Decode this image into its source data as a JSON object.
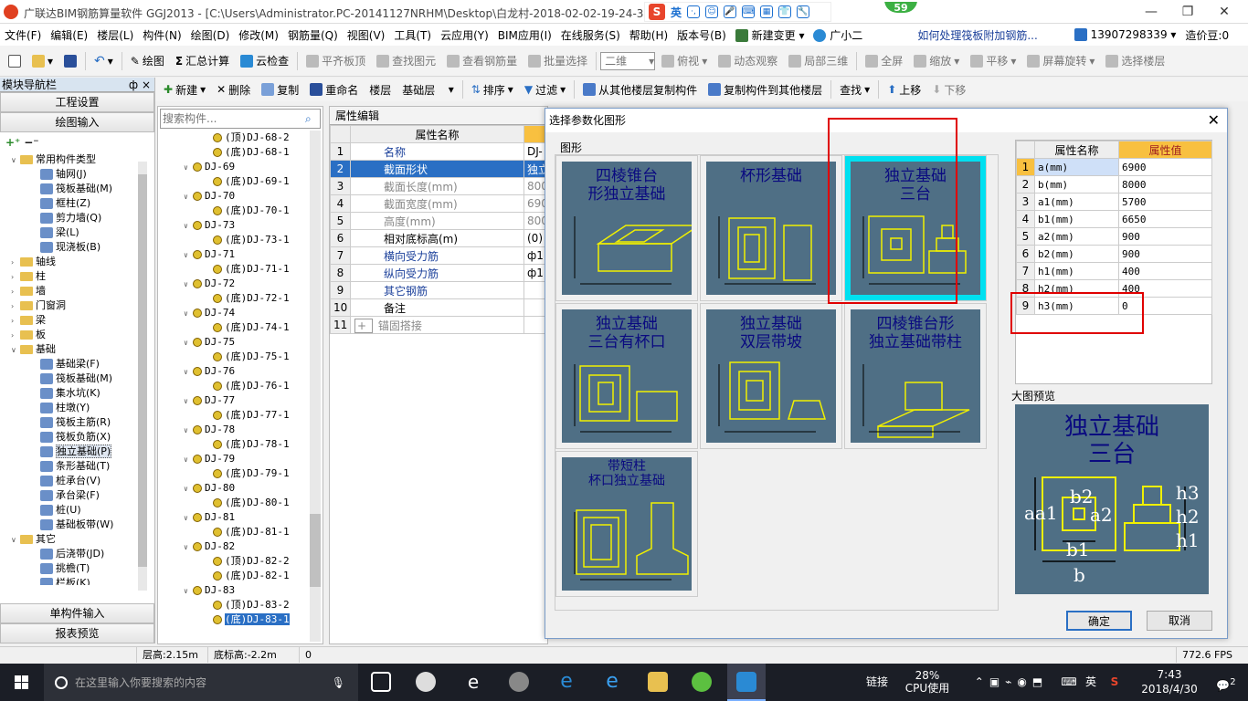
{
  "window": {
    "title": "广联达BIM钢筋算量软件 GGJ2013 - [C:\\Users\\Administrator.PC-20141127NRHM\\Desktop\\白龙村-2018-02-02-19-24-35"
  },
  "ime": {
    "lang": "英",
    "brand": "S"
  },
  "notify_badge": "59",
  "menu": [
    "文件(F)",
    "编辑(E)",
    "楼层(L)",
    "构件(N)",
    "绘图(D)",
    "修改(M)",
    "钢筋量(Q)",
    "视图(V)",
    "工具(T)",
    "云应用(Y)",
    "BIM应用(I)",
    "在线服务(S)",
    "帮助(H)",
    "版本号(B)",
    "新建变更",
    "广小二",
    "如何处理筏板附加钢筋...",
    "13907298339",
    "造价豆:0"
  ],
  "toolbar1": {
    "draw": "绘图",
    "sum": "汇总计算",
    "cloud_check": "云检查",
    "flat_top": "平齐板顶",
    "find_elem": "查找图元",
    "view_rebar": "查看钢筋量",
    "batch_select": "批量选择",
    "view2d": "二维",
    "top_view": "俯视",
    "dynamic": "动态观察",
    "local3d": "局部三维",
    "fullscreen": "全屏",
    "zoom": "缩放",
    "pan": "平移",
    "rotate": "屏幕旋转",
    "select_floor": "选择楼层"
  },
  "toolbar2": {
    "new": "新建",
    "delete": "删除",
    "copy": "复制",
    "rename": "重命名",
    "floor_label": "楼层",
    "floor_value": "基础层",
    "sort": "排序",
    "filter": "过滤",
    "copy_from": "从其他楼层复制构件",
    "copy_to": "复制构件到其他楼层",
    "find": "查找",
    "up": "上移",
    "down": "下移"
  },
  "nav": {
    "title": "模块导航栏",
    "pin": "ф",
    "close": "×",
    "btn_settings": "工程设置",
    "btn_draw": "绘图输入",
    "btn_single": "单构件输入",
    "btn_report": "报表预览",
    "tree": [
      {
        "level": 0,
        "label": "常用构件类型",
        "type": "folder",
        "open": true
      },
      {
        "level": 1,
        "label": "轴网(J)",
        "type": "item"
      },
      {
        "level": 1,
        "label": "筏板基础(M)",
        "type": "item"
      },
      {
        "level": 1,
        "label": "框柱(Z)",
        "type": "item"
      },
      {
        "level": 1,
        "label": "剪力墙(Q)",
        "type": "item"
      },
      {
        "level": 1,
        "label": "梁(L)",
        "type": "item"
      },
      {
        "level": 1,
        "label": "现浇板(B)",
        "type": "item"
      },
      {
        "level": 0,
        "label": "轴线",
        "type": "folder",
        "open": false
      },
      {
        "level": 0,
        "label": "柱",
        "type": "folder",
        "open": false
      },
      {
        "level": 0,
        "label": "墙",
        "type": "folder",
        "open": false
      },
      {
        "level": 0,
        "label": "门窗洞",
        "type": "folder",
        "open": false
      },
      {
        "level": 0,
        "label": "梁",
        "type": "folder",
        "open": false
      },
      {
        "level": 0,
        "label": "板",
        "type": "folder",
        "open": false
      },
      {
        "level": 0,
        "label": "基础",
        "type": "folder",
        "open": true
      },
      {
        "level": 1,
        "label": "基础梁(F)",
        "type": "item"
      },
      {
        "level": 1,
        "label": "筏板基础(M)",
        "type": "item"
      },
      {
        "level": 1,
        "label": "集水坑(K)",
        "type": "item"
      },
      {
        "level": 1,
        "label": "柱墩(Y)",
        "type": "item"
      },
      {
        "level": 1,
        "label": "筏板主筋(R)",
        "type": "item"
      },
      {
        "level": 1,
        "label": "筏板负筋(X)",
        "type": "item"
      },
      {
        "level": 1,
        "label": "独立基础(P)",
        "type": "item",
        "selected": true
      },
      {
        "level": 1,
        "label": "条形基础(T)",
        "type": "item"
      },
      {
        "level": 1,
        "label": "桩承台(V)",
        "type": "item"
      },
      {
        "level": 1,
        "label": "承台梁(F)",
        "type": "item"
      },
      {
        "level": 1,
        "label": "桩(U)",
        "type": "item"
      },
      {
        "level": 1,
        "label": "基础板带(W)",
        "type": "item"
      },
      {
        "level": 0,
        "label": "其它",
        "type": "folder",
        "open": true
      },
      {
        "level": 1,
        "label": "后浇带(JD)",
        "type": "item"
      },
      {
        "level": 1,
        "label": "挑檐(T)",
        "type": "item"
      },
      {
        "level": 1,
        "label": "栏板(K)",
        "type": "item"
      }
    ]
  },
  "search": {
    "placeholder": "搜索构件..."
  },
  "comp_tree": [
    {
      "level": 1,
      "label": "(顶)DJ-68-2"
    },
    {
      "level": 1,
      "label": "(底)DJ-68-1"
    },
    {
      "level": 0,
      "label": "DJ-69"
    },
    {
      "level": 1,
      "label": "(底)DJ-69-1"
    },
    {
      "level": 0,
      "label": "DJ-70"
    },
    {
      "level": 1,
      "label": "(底)DJ-70-1"
    },
    {
      "level": 0,
      "label": "DJ-73"
    },
    {
      "level": 1,
      "label": "(底)DJ-73-1"
    },
    {
      "level": 0,
      "label": "DJ-71"
    },
    {
      "level": 1,
      "label": "(底)DJ-71-1"
    },
    {
      "level": 0,
      "label": "DJ-72"
    },
    {
      "level": 1,
      "label": "(底)DJ-72-1"
    },
    {
      "level": 0,
      "label": "DJ-74"
    },
    {
      "level": 1,
      "label": "(底)DJ-74-1"
    },
    {
      "level": 0,
      "label": "DJ-75"
    },
    {
      "level": 1,
      "label": "(底)DJ-75-1"
    },
    {
      "level": 0,
      "label": "DJ-76"
    },
    {
      "level": 1,
      "label": "(底)DJ-76-1"
    },
    {
      "level": 0,
      "label": "DJ-77"
    },
    {
      "level": 1,
      "label": "(底)DJ-77-1"
    },
    {
      "level": 0,
      "label": "DJ-78"
    },
    {
      "level": 1,
      "label": "(底)DJ-78-1"
    },
    {
      "level": 0,
      "label": "DJ-79"
    },
    {
      "level": 1,
      "label": "(底)DJ-79-1"
    },
    {
      "level": 0,
      "label": "DJ-80"
    },
    {
      "level": 1,
      "label": "(底)DJ-80-1"
    },
    {
      "level": 0,
      "label": "DJ-81"
    },
    {
      "level": 1,
      "label": "(底)DJ-81-1"
    },
    {
      "level": 0,
      "label": "DJ-82"
    },
    {
      "level": 1,
      "label": "(顶)DJ-82-2"
    },
    {
      "level": 1,
      "label": "(底)DJ-82-1"
    },
    {
      "level": 0,
      "label": "DJ-83"
    },
    {
      "level": 1,
      "label": "(顶)DJ-83-2"
    },
    {
      "level": 1,
      "label": "(底)DJ-83-1",
      "selected": true
    }
  ],
  "prop": {
    "tab": "属性编辑",
    "col_name": "属性名称",
    "col_value": "",
    "rows": [
      {
        "n": "1",
        "name": "名称",
        "value": "DJ-",
        "style": "blue"
      },
      {
        "n": "2",
        "name": "截面形状",
        "value": "独立",
        "style": "sel"
      },
      {
        "n": "3",
        "name": "截面长度(mm)",
        "value": "800",
        "style": "gray"
      },
      {
        "n": "4",
        "name": "截面宽度(mm)",
        "value": "690",
        "style": "gray"
      },
      {
        "n": "5",
        "name": "高度(mm)",
        "value": "800",
        "style": "gray"
      },
      {
        "n": "6",
        "name": "相对底标高(m)",
        "value": "(0)",
        "style": "normal"
      },
      {
        "n": "7",
        "name": "横向受力筋",
        "value": "ф1",
        "style": "blue"
      },
      {
        "n": "8",
        "name": "纵向受力筋",
        "value": "ф1",
        "style": "blue"
      },
      {
        "n": "9",
        "name": "其它钢筋",
        "value": "",
        "style": "blue"
      },
      {
        "n": "10",
        "name": "备注",
        "value": "",
        "style": "normal"
      },
      {
        "n": "11",
        "name": "锚固搭接",
        "value": "",
        "style": "gray",
        "expand": "+"
      }
    ]
  },
  "dialog": {
    "title": "选择参数化图形",
    "group_label": "图形",
    "shapes": [
      {
        "title": "四棱锥台\n形独立基础",
        "selected": false
      },
      {
        "title": "杯形基础",
        "selected": false
      },
      {
        "title": "独立基础\n三台",
        "selected": true
      },
      {
        "title": "独立基础\n三台有杯口",
        "selected": false
      },
      {
        "title": "独立基础\n双层带坡",
        "selected": false
      },
      {
        "title": "四棱锥台形\n独立基础带柱",
        "selected": false
      },
      {
        "title": "带短柱\n杯口独立基础",
        "selected": false
      }
    ],
    "param_head_name": "属性名称",
    "param_head_value": "属性值",
    "params": [
      {
        "n": "1",
        "name": "a(mm)",
        "value": "6900"
      },
      {
        "n": "2",
        "name": "b(mm)",
        "value": "8000"
      },
      {
        "n": "3",
        "name": "a1(mm)",
        "value": "5700"
      },
      {
        "n": "4",
        "name": "b1(mm)",
        "value": "6650"
      },
      {
        "n": "5",
        "name": "a2(mm)",
        "value": "900"
      },
      {
        "n": "6",
        "name": "b2(mm)",
        "value": "900"
      },
      {
        "n": "7",
        "name": "h1(mm)",
        "value": "400"
      },
      {
        "n": "8",
        "name": "h2(mm)",
        "value": "400"
      },
      {
        "n": "9",
        "name": "h3(mm)",
        "value": "0"
      }
    ],
    "preview_label": "大图预览",
    "preview_title": "独立基础\n三台",
    "ok": "确定",
    "cancel": "取消"
  },
  "status": {
    "floor_height": "层高:2.15m",
    "bottom_elev": "底标高:-2.2m",
    "val": "0",
    "fps": "772.6 FPS"
  },
  "taskbar": {
    "search_placeholder": "在这里输入你要搜索的内容",
    "link": "链接",
    "cpu_pct": "28%",
    "cpu_label": "CPU使用",
    "lang": "英",
    "time": "7:43",
    "date": "2018/4/30",
    "notif": "2"
  },
  "colors": {
    "accent": "#2a6fc4",
    "shape_bg": "#4f6f85",
    "shape_line": "#f0f000",
    "selected_shape": "#00e0f0",
    "highlight": "#e00000"
  }
}
